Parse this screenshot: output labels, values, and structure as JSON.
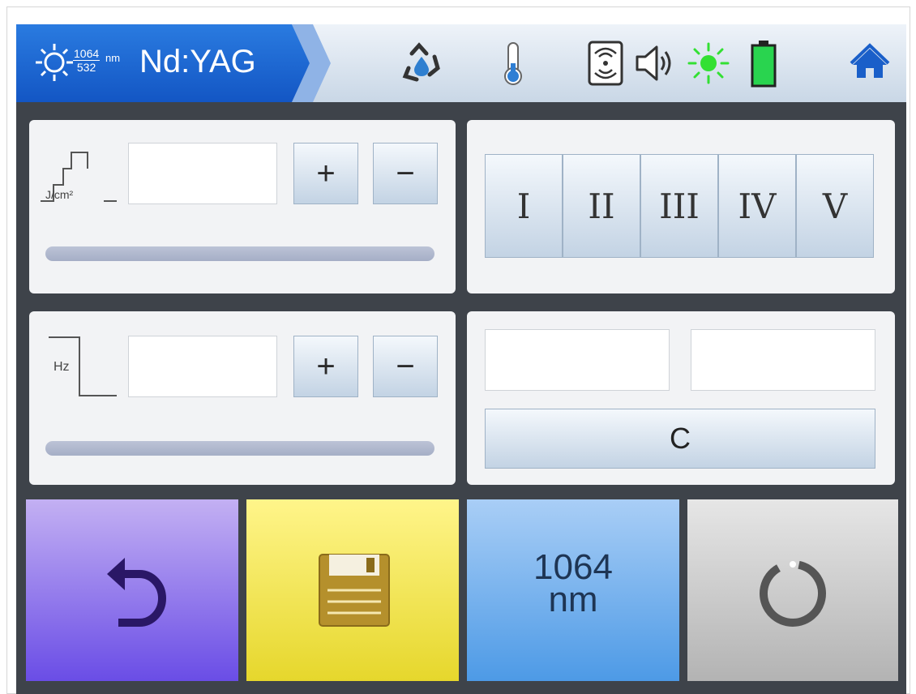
{
  "header": {
    "title": "Nd:YAG",
    "wavelength_top": "1064",
    "wavelength_bottom": "532",
    "wavelength_unit": "nm",
    "icons": [
      "sun-icon",
      "recycle-water-icon",
      "thermometer-icon",
      "proximity-sensor-icon",
      "speaker-icon",
      "indicator-light-icon",
      "battery-icon",
      "home-icon"
    ],
    "colors": {
      "brand_blue": "#1E6AD6",
      "light_green": "#33E033",
      "battery_green": "#29D44F",
      "home_blue": "#1A5FC9"
    }
  },
  "energy_panel": {
    "unit": "J/cm²",
    "value": "",
    "plus_label": "+",
    "minus_label": "−"
  },
  "frequency_panel": {
    "unit": "Hz",
    "value": "",
    "plus_label": "+",
    "minus_label": "−"
  },
  "mode_panel": {
    "buttons": [
      "I",
      "II",
      "III",
      "IV",
      "V"
    ]
  },
  "counter_panel": {
    "field1": "",
    "field2": "",
    "clear_label": "C"
  },
  "bottom_bar": {
    "wavelength_value": "1064",
    "wavelength_unit": "nm",
    "colors": {
      "back": "#7E63EA",
      "save": "#F2E448",
      "wavelength": "#6FB0F0",
      "standby": "#C9C9C9"
    }
  }
}
